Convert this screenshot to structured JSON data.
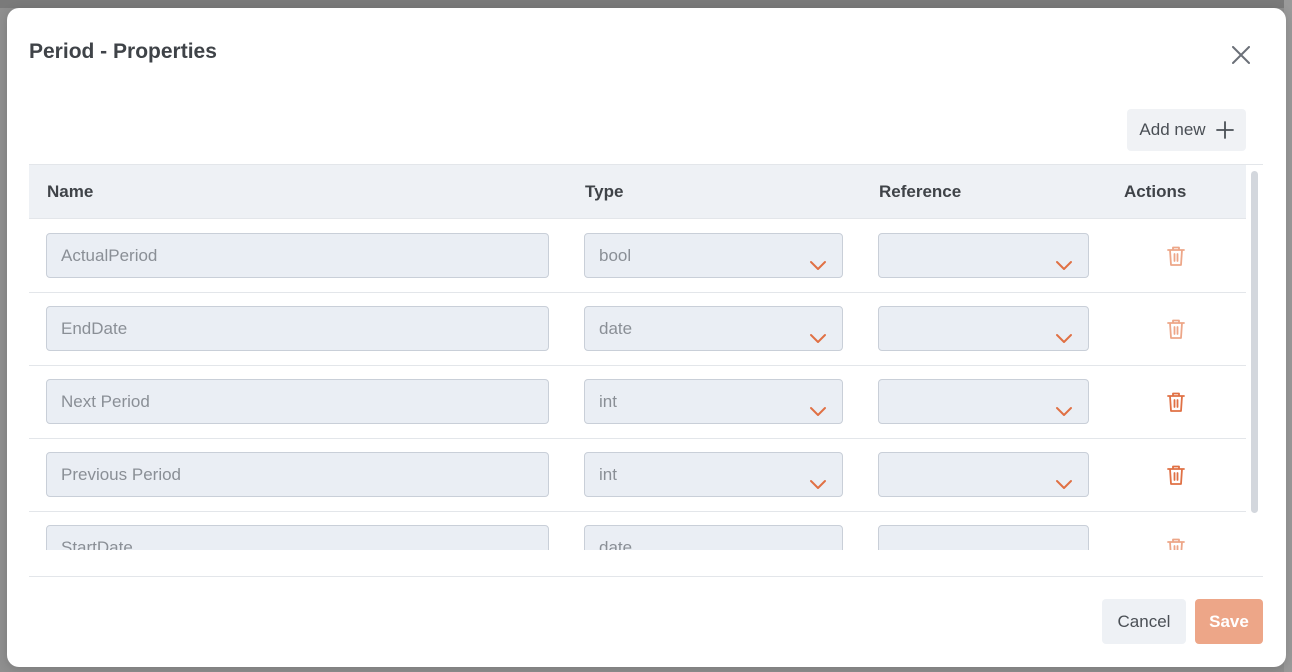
{
  "dialog": {
    "title": "Period - Properties",
    "add_label": "Add new",
    "cancel_label": "Cancel",
    "save_label": "Save"
  },
  "table": {
    "columns": [
      "Name",
      "Type",
      "Reference",
      "Actions"
    ],
    "rows": [
      {
        "name": "ActualPeriod",
        "type": "bool",
        "reference": "",
        "delete_enabled": false
      },
      {
        "name": "EndDate",
        "type": "date",
        "reference": "",
        "delete_enabled": false
      },
      {
        "name": "Next Period",
        "type": "int",
        "reference": "",
        "delete_enabled": true
      },
      {
        "name": "Previous Period",
        "type": "int",
        "reference": "",
        "delete_enabled": true
      },
      {
        "name": "StartDate",
        "type": "date",
        "reference": "",
        "delete_enabled": false
      }
    ]
  },
  "icons": {
    "close": "close-icon",
    "add": "plus-icon",
    "dropdown": "chevron-down-icon",
    "delete": "trash-icon"
  },
  "colors": {
    "accent": "#e07044",
    "accent_disabled": "#eda688",
    "field_bg": "#eaeef4",
    "header_bg": "#eef1f5"
  }
}
